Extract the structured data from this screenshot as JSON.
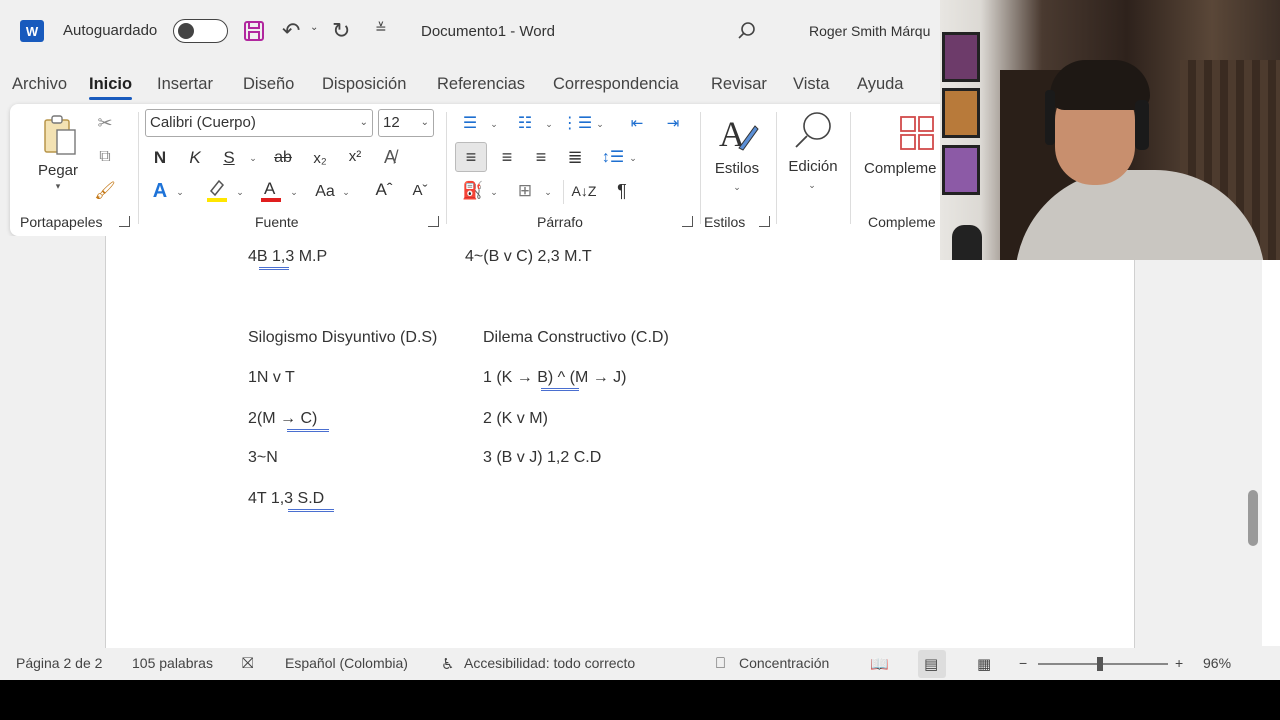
{
  "titlebar": {
    "app_icon": "W",
    "autosave_label": "Autoguardado",
    "doc_title": "Documento1  -  Word",
    "user_name": "Roger Smith Márqu"
  },
  "tabs": [
    "Archivo",
    "Inicio",
    "Insertar",
    "Diseño",
    "Disposición",
    "Referencias",
    "Correspondencia",
    "Revisar",
    "Vista",
    "Ayuda"
  ],
  "ribbon": {
    "paste_label": "Pegar",
    "font_name": "Calibri (Cuerpo)",
    "font_size": "12",
    "bold": "N",
    "italic": "K",
    "underline": "S",
    "strike": "ab",
    "subscript": "x₂",
    "superscript": "x²",
    "change_case": "Aa",
    "grow_font": "Aˆ",
    "shrink_font": "Aˇ",
    "pilcrow": "¶",
    "styles_label": "Estilos",
    "editing_label": "Edición",
    "addins_label": "Compleme",
    "groups": {
      "clipboard": "Portapapeles",
      "font": "Fuente",
      "paragraph": "Párrafo",
      "styles": "Estilos",
      "addins": "Compleme"
    }
  },
  "document": {
    "top_left": "4B  1,3 M.P",
    "top_right": "4~(B v C) 2,3 M.T",
    "left_heading": "Silogismo Disyuntivo (D.S)",
    "right_heading": "Dilema Constructivo (C.D)",
    "left_lines": [
      "1N v T",
      "2(M → C)",
      "3~N",
      "4T 1,3  S.D"
    ],
    "right_lines": [
      "1 (K → B)  ^  (M → J)",
      "2 (K v M)",
      "3 (B v J) 1,2 C.D"
    ]
  },
  "statusbar": {
    "page": "Página 2 de 2",
    "words": "105 palabras",
    "language": "Español (Colombia)",
    "accessibility": "Accesibilidad: todo correcto",
    "focus": "Concentración",
    "zoom_minus": "−",
    "zoom_plus": "+",
    "zoom": "96%"
  }
}
